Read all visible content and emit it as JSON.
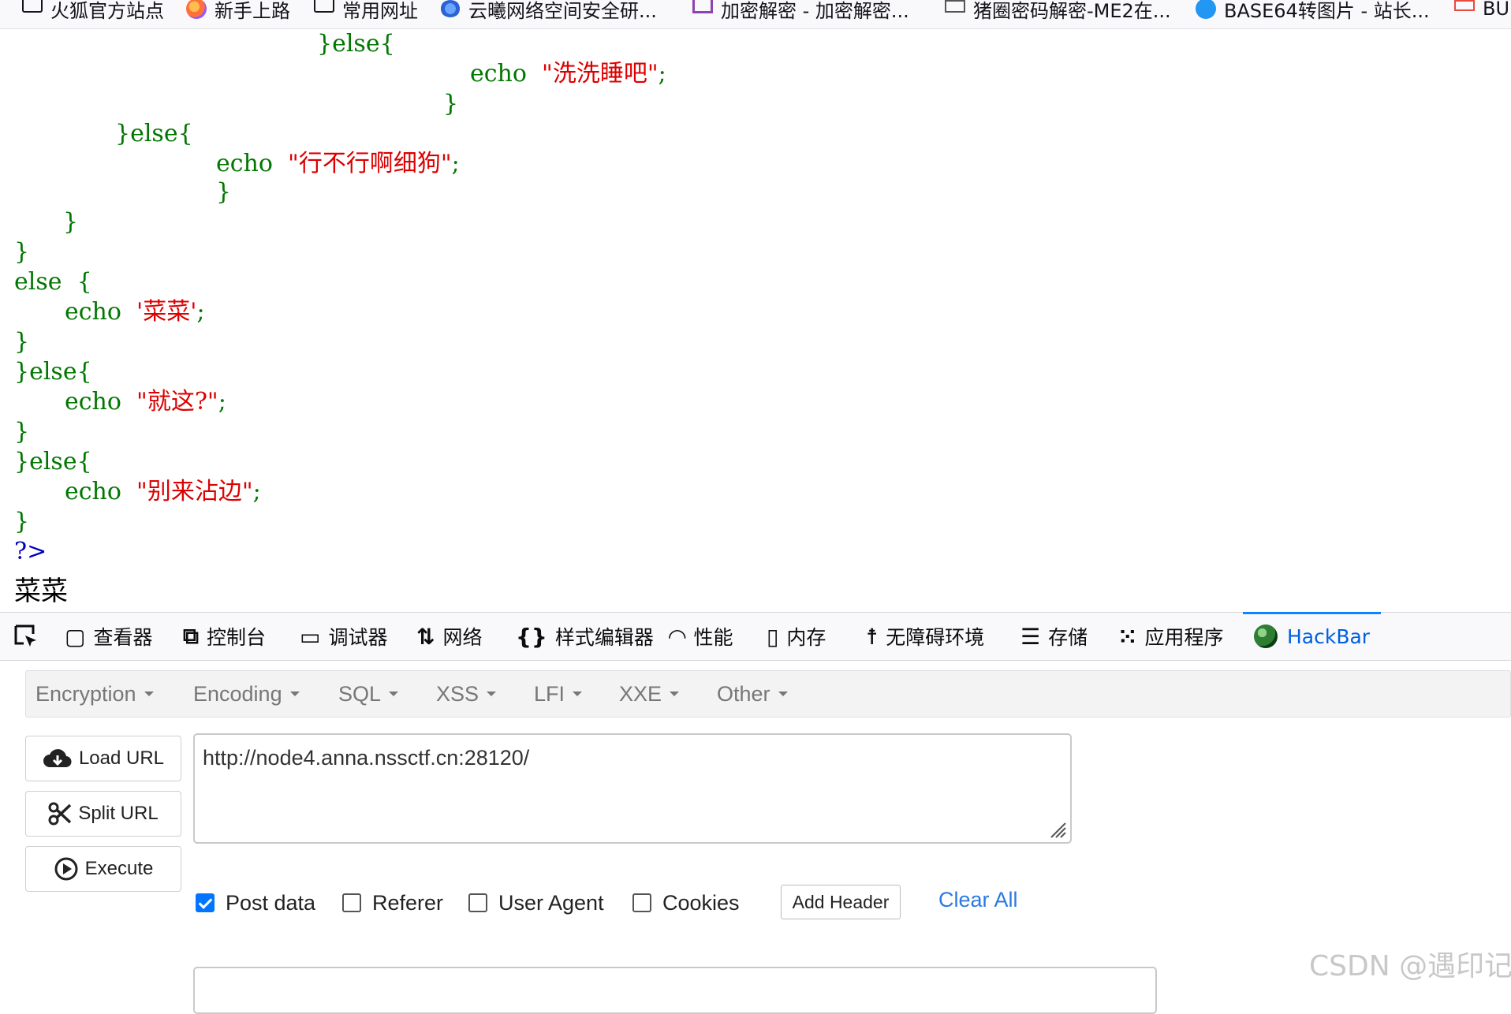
{
  "bookmarks": [
    {
      "label": "火狐官方站点",
      "icon": "folder-icon"
    },
    {
      "label": "新手上路",
      "icon": "firefox-icon"
    },
    {
      "label": "常用网址",
      "icon": "folder-icon"
    },
    {
      "label": "云曦网络空间安全研...",
      "icon": "cloud-logo-icon"
    },
    {
      "label": "加密解密 - 加密解密...",
      "icon": "purple-site-icon"
    },
    {
      "label": "猪圈密码解密-ME2在...",
      "icon": "mail-icon"
    },
    {
      "label": "BASE64转图片 - 站长...",
      "icon": "bolt-icon"
    },
    {
      "label": "BU",
      "icon": "red-site-icon"
    }
  ],
  "source_code": {
    "l1": {
      "a": "}else{"
    },
    "l2": {
      "a": "echo  ",
      "s": "\"洗洗睡吧\"",
      "c": ";"
    },
    "l3": {
      "a": "}"
    },
    "l4": {
      "a": "}else{"
    },
    "l5": {
      "a": "echo  ",
      "s": "\"行不行啊细狗\"",
      "c": ";"
    },
    "l6": {
      "a": "}"
    },
    "l7": {
      "a": "}"
    },
    "l8": {
      "a": "}"
    },
    "l9": {
      "a": "else  {"
    },
    "l10": {
      "a": "echo  ",
      "s": "'菜菜'",
      "c": ";"
    },
    "l11": {
      "a": "}"
    },
    "l12": {
      "a": "}else{"
    },
    "l13": {
      "a": "echo  ",
      "s": "\"就这?\"",
      "c": ";"
    },
    "l14": {
      "a": "}"
    },
    "l15": {
      "a": "}else{"
    },
    "l16": {
      "a": "echo  ",
      "s": "\"别来沾边\"",
      "c": ";"
    },
    "l17": {
      "a": "}"
    },
    "l18": {
      "a": "?>"
    }
  },
  "page_output": "菜菜",
  "devtools": {
    "tabs": [
      {
        "label": "查看器",
        "icon": "inspector-icon"
      },
      {
        "label": "控制台",
        "icon": "console-icon"
      },
      {
        "label": "调试器",
        "icon": "debugger-icon"
      },
      {
        "label": "网络",
        "icon": "network-icon"
      },
      {
        "label": "样式编辑器",
        "icon": "style-editor-icon"
      },
      {
        "label": "性能",
        "icon": "performance-icon"
      },
      {
        "label": "内存",
        "icon": "memory-icon"
      },
      {
        "label": "无障碍环境",
        "icon": "accessibility-icon"
      },
      {
        "label": "存储",
        "icon": "storage-icon"
      },
      {
        "label": "应用程序",
        "icon": "application-icon"
      },
      {
        "label": "HackBar",
        "icon": "hackbar-icon",
        "active": true
      }
    ]
  },
  "hackbar": {
    "menu": [
      "Encryption",
      "Encoding",
      "SQL",
      "XSS",
      "LFI",
      "XXE",
      "Other"
    ],
    "load_url": "Load URL",
    "split_url": "Split URL",
    "execute": "Execute",
    "url_value": "http://node4.anna.nssctf.cn:28120/",
    "options": {
      "post_data": {
        "label": "Post data",
        "checked": true
      },
      "referer": {
        "label": "Referer",
        "checked": false
      },
      "user_agent": {
        "label": "User Agent",
        "checked": false
      },
      "cookies": {
        "label": "Cookies",
        "checked": false
      }
    },
    "add_header": "Add Header",
    "clear_all": "Clear All"
  },
  "colors": {
    "php_keyword": "#007700",
    "php_string": "#dd0000",
    "php_tag": "#0000bb",
    "active_tab": "#0060df",
    "link": "#2a7ae2",
    "checkbox_on": "#0075ff"
  },
  "watermark": "CSDN @遇印记"
}
